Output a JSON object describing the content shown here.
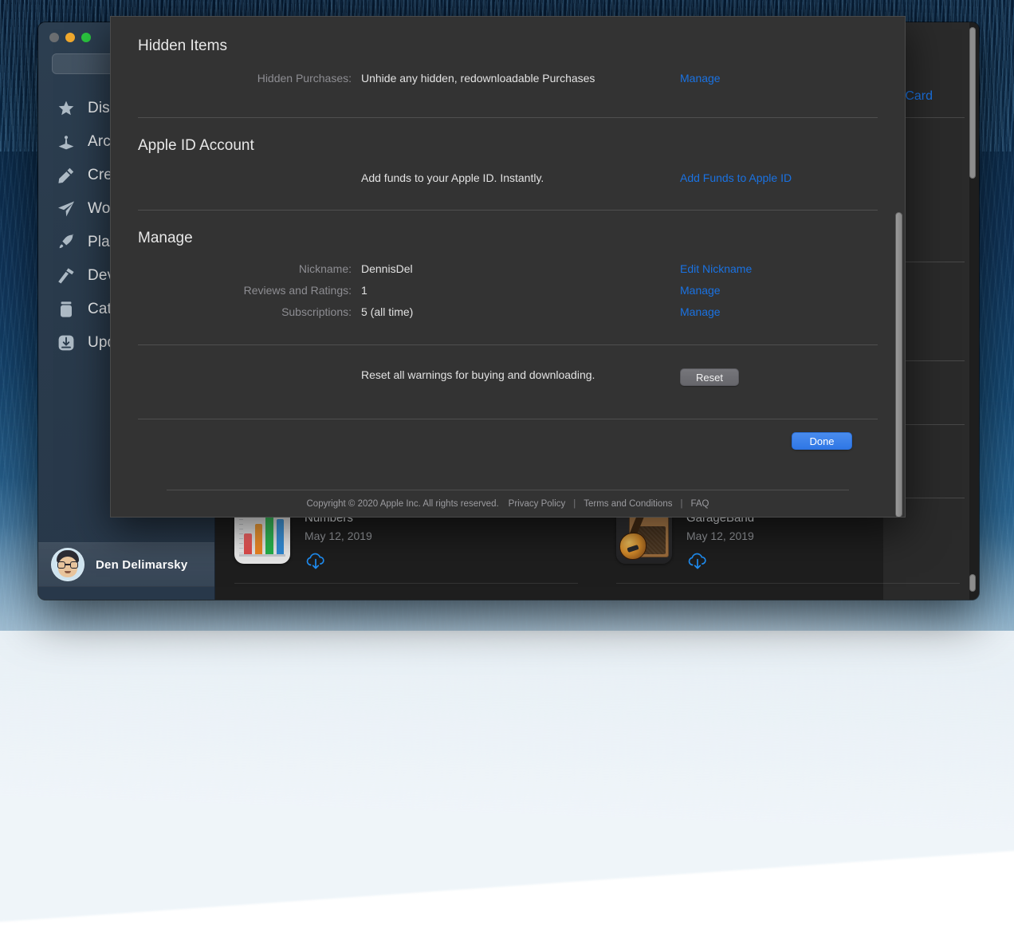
{
  "window": {
    "traffic_lights": [
      "close",
      "minimize",
      "zoom"
    ],
    "search_placeholder": ""
  },
  "sidebar": {
    "items": [
      {
        "label": "Discover",
        "icon": "star-icon"
      },
      {
        "label": "Arcade",
        "icon": "arcade-icon"
      },
      {
        "label": "Create",
        "icon": "create-icon"
      },
      {
        "label": "Work",
        "icon": "paper-plane-icon"
      },
      {
        "label": "Play",
        "icon": "rocket-icon"
      },
      {
        "label": "Develop",
        "icon": "hammer-icon"
      },
      {
        "label": "Categories",
        "icon": "jar-icon"
      },
      {
        "label": "Updates",
        "icon": "download-box-icon"
      }
    ],
    "account": {
      "name": "Den Delimarsky"
    }
  },
  "background_content": {
    "partial_link": "Card",
    "purchases": [
      {
        "title": "Numbers",
        "date": "May 12, 2019",
        "action": "download-cloud-icon"
      },
      {
        "title": "GarageBand",
        "date": "May 12, 2019",
        "action": "download-cloud-icon"
      }
    ]
  },
  "sheet": {
    "sections": {
      "hidden_items": {
        "title": "Hidden Items",
        "rows": [
          {
            "label": "Hidden Purchases:",
            "value": "Unhide any hidden, redownloadable Purchases",
            "action": "Manage"
          }
        ]
      },
      "apple_id_account": {
        "title": "Apple ID Account",
        "rows": [
          {
            "label": "",
            "value": "Add funds to your Apple ID. Instantly.",
            "action": "Add Funds to Apple ID"
          }
        ]
      },
      "manage": {
        "title": "Manage",
        "rows": [
          {
            "label": "Nickname:",
            "value": "DennisDel",
            "action": "Edit Nickname"
          },
          {
            "label": "Reviews and Ratings:",
            "value": "1",
            "action": "Manage"
          },
          {
            "label": "Subscriptions:",
            "value": "5 (all time)",
            "action": "Manage"
          }
        ]
      },
      "reset": {
        "value": "Reset all warnings for buying and downloading.",
        "button": "Reset"
      }
    },
    "done_button": "Done",
    "footer": {
      "copyright": "Copyright © 2020 Apple Inc. All rights reserved.",
      "links": [
        "Privacy Policy",
        "Terms and Conditions",
        "FAQ"
      ],
      "divider": "|"
    }
  },
  "colors": {
    "link_blue": "#1a72e2",
    "done_blue": "#3b7fe8",
    "sheet_bg": "#333333",
    "label_gray": "#8d8d92",
    "value_gray": "#e2e2e2"
  }
}
